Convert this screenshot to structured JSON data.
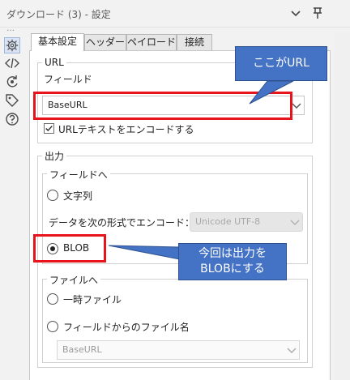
{
  "window": {
    "title": "ダウンロード (3) - 設定",
    "more": "…"
  },
  "tabs": [
    "基本設定",
    "ヘッダー",
    "ペイロード",
    "接続"
  ],
  "url_section": {
    "title": "URL",
    "field_label": "フィールド",
    "field_value": "BaseURL",
    "encode_label": "URLテキストをエンコードする",
    "encode_checked": true
  },
  "output_section": {
    "title": "出力",
    "to_field_title": "フィールドへ",
    "string_option": "文字列",
    "encode_label": "データを次の形式でエンコード：",
    "encode_value": "Unicode UTF-8",
    "blob_option": "BLOB",
    "blob_selected": true,
    "to_file_title": "ファイルへ",
    "temp_file_option": "一時ファイル",
    "filename_option": "フィールドからのファイル名",
    "filename_value": "BaseURL"
  },
  "callouts": {
    "url_note": "ここがURL",
    "blob_note_line1": "今回は出力を",
    "blob_note_line2": "BLOBにする"
  },
  "colors": {
    "highlight": "#e8141c",
    "callout_fill": "#4472c4",
    "rail_selected": "#d9e3f3"
  },
  "icons": [
    "gear-icon",
    "code-icon",
    "refresh-icon",
    "tag-icon",
    "help-icon",
    "chevron-down-icon",
    "pin-icon",
    "checkmark-icon"
  ]
}
